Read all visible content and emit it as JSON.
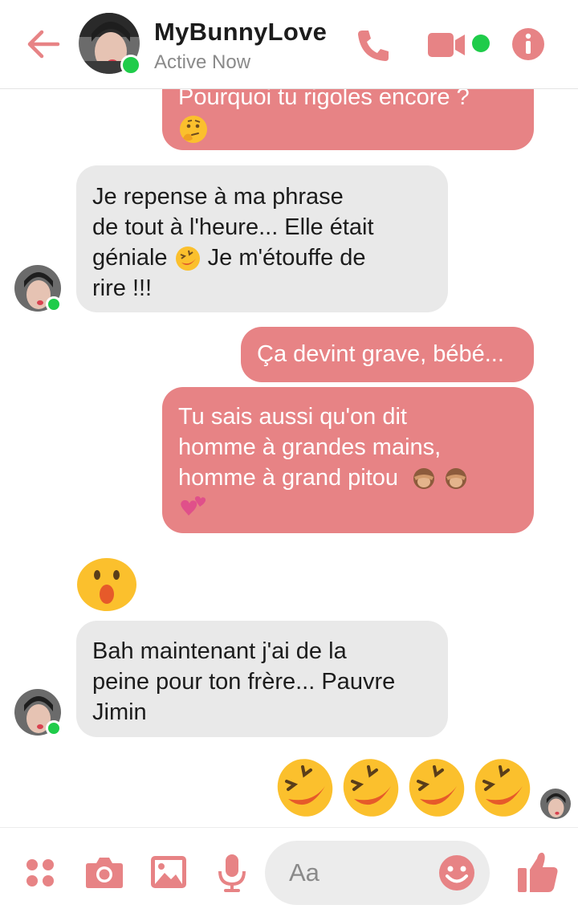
{
  "header": {
    "contact_name": "MyBunnyLove",
    "status": "Active Now"
  },
  "messages": {
    "m1": "Pourquoi tu rigoles encore ?",
    "m2_line1": "Je repense à ma phrase",
    "m2_line2": "de tout à l'heure... Elle était",
    "m2_line3a": "géniale",
    "m2_line3b": "Je m'étouffe de",
    "m2_line4": "rire !!!",
    "m3": "Ça devint grave, bébé...",
    "m4_line1": "Tu sais aussi qu'on dit",
    "m4_line2": "homme à grandes mains,",
    "m4_line3": "homme à grand pitou",
    "m5_line1": "Bah maintenant j'ai de la",
    "m5_line2": "peine pour ton frère... Pauvre",
    "m5_line3": "Jimin"
  },
  "composer": {
    "placeholder": "Aa"
  },
  "colors": {
    "accent": "#e78385",
    "online": "#1fcc4a",
    "incoming_bubble": "#e9e9e9"
  }
}
